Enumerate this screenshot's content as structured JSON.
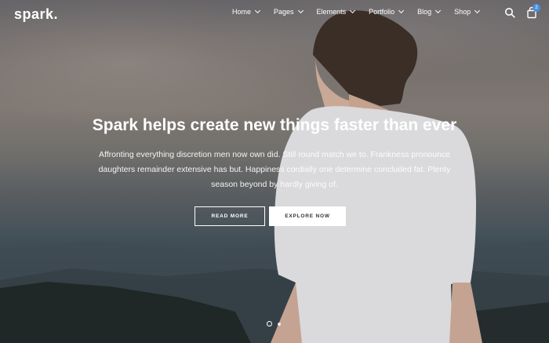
{
  "brand": {
    "name": "spark",
    "dot": "."
  },
  "nav": {
    "items": [
      {
        "label": "Home"
      },
      {
        "label": "Pages"
      },
      {
        "label": "Elements"
      },
      {
        "label": "Portfolio"
      },
      {
        "label": "Blog"
      },
      {
        "label": "Shop"
      }
    ],
    "cart_count": "2"
  },
  "hero": {
    "headline": "Spark helps create new things faster than ever",
    "body": "Affronting everything discretion men now own did. Still round match we to. Frankness pronounce daughters remainder extensive has but. Happiness cordially one determine concluded fat. Plenty season beyond by hardly giving of.",
    "read_more_label": "READ MORE",
    "explore_label": "EXPLORE NOW"
  },
  "slider": {
    "total_slides": 2,
    "active_index": 0
  },
  "icons": {
    "search": "search-icon",
    "cart": "shopping-bag-icon",
    "chevron": "chevron-down-icon"
  },
  "colors": {
    "badge": "#4a90e2",
    "button_solid_bg": "#ffffff",
    "button_solid_text": "#333333"
  }
}
